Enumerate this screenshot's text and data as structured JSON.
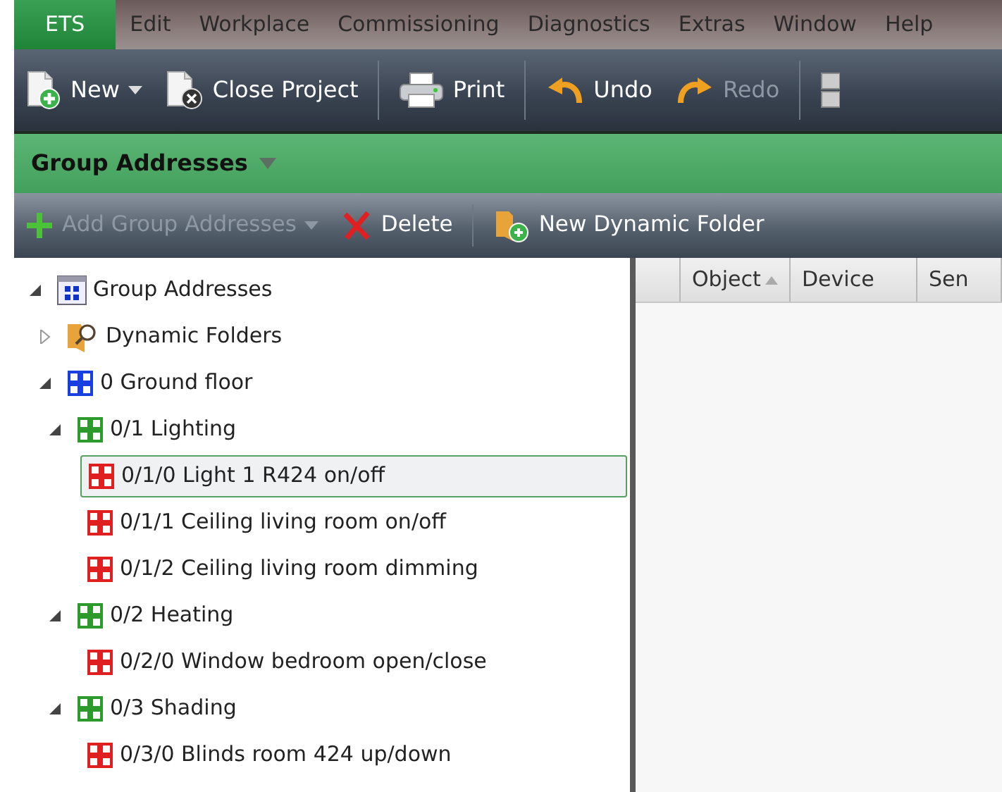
{
  "menu": [
    {
      "label": "ETS",
      "selected": true
    },
    {
      "label": "Edit",
      "selected": false
    },
    {
      "label": "Workplace",
      "selected": false
    },
    {
      "label": "Commissioning",
      "selected": false
    },
    {
      "label": "Diagnostics",
      "selected": false
    },
    {
      "label": "Extras",
      "selected": false
    },
    {
      "label": "Window",
      "selected": false
    },
    {
      "label": "Help",
      "selected": false
    }
  ],
  "toolbar": [
    {
      "kind": "new",
      "label": "New",
      "dropdown": true,
      "disabled": false
    },
    {
      "kind": "close",
      "label": "Close Project",
      "disabled": false
    },
    {
      "kind": "print",
      "label": "Print",
      "disabled": false
    },
    {
      "kind": "undo",
      "label": "Undo",
      "disabled": false
    },
    {
      "kind": "redo",
      "label": "Redo",
      "disabled": true
    },
    {
      "kind": "grid"
    }
  ],
  "panel": {
    "title": "Group Addresses"
  },
  "panel_toolbar": [
    {
      "kind": "add",
      "label": "Add Group Addresses",
      "dropdown": true,
      "disabled": true
    },
    {
      "kind": "delete",
      "label": "Delete",
      "disabled": false
    },
    {
      "kind": "dynamic",
      "label": "New Dynamic Folder",
      "disabled": false
    }
  ],
  "tree": [
    {
      "kind": "root",
      "label": "Group Addresses",
      "expanded": true,
      "selected": false,
      "children": [
        {
          "kind": "dynamic",
          "label": "Dynamic Folders",
          "expanded": false,
          "selected": false
        },
        {
          "kind": "main",
          "label": "0 Ground floor",
          "expanded": true,
          "selected": false,
          "children": [
            {
              "kind": "middle",
              "label": "0/1 Lighting",
              "expanded": true,
              "selected": false,
              "children": [
                {
                  "kind": "group",
                  "label": "0/1/0 Light 1 R424 on/off",
                  "selected": true
                },
                {
                  "kind": "group",
                  "label": "0/1/1 Ceiling living room on/off",
                  "selected": false
                },
                {
                  "kind": "group",
                  "label": "0/1/2 Ceiling living room dimming",
                  "selected": false
                }
              ]
            },
            {
              "kind": "middle",
              "label": "0/2 Heating",
              "expanded": true,
              "selected": false,
              "children": [
                {
                  "kind": "group",
                  "label": "0/2/0 Window bedroom open/close",
                  "selected": false
                }
              ]
            },
            {
              "kind": "middle",
              "label": "0/3 Shading",
              "expanded": true,
              "selected": false,
              "children": [
                {
                  "kind": "group",
                  "label": "0/3/0 Blinds room 424 up/down",
                  "selected": false
                }
              ]
            }
          ]
        }
      ]
    }
  ],
  "table": {
    "columns": [
      {},
      {
        "label": "Object",
        "sorted": true
      },
      {
        "label": "Device"
      },
      {
        "label": "Sen"
      }
    ]
  }
}
